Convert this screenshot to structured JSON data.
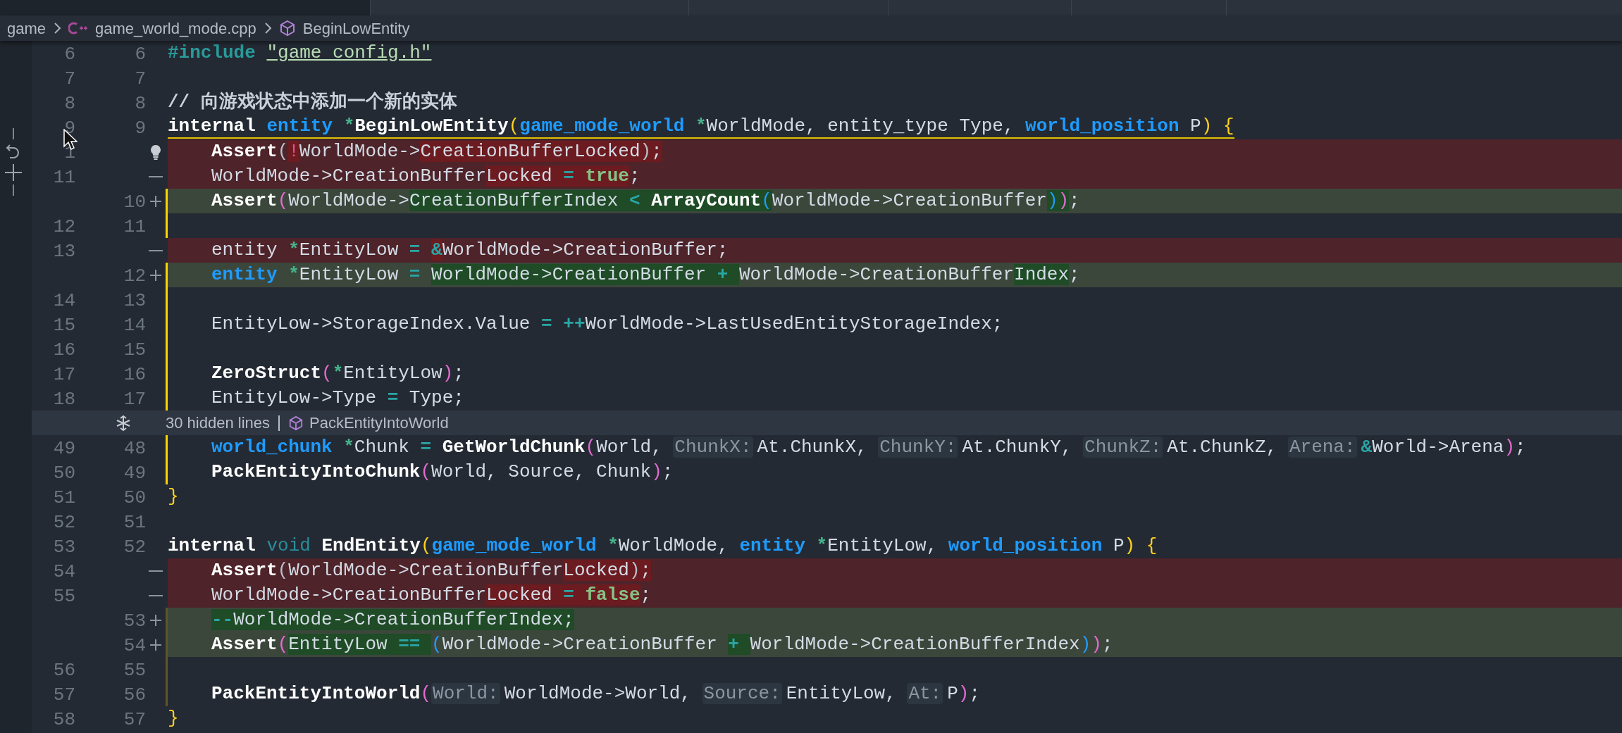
{
  "breadcrumb": [
    {
      "kind": "folder",
      "label": "game"
    },
    {
      "kind": "cpp_file",
      "label": "game_world_mode.cpp"
    },
    {
      "kind": "symbol",
      "label": "BeginLowEntity"
    }
  ],
  "blocks": [
    {
      "kind": "lines",
      "lines": [
        {
          "kind": "context",
          "old": "6",
          "new": "6",
          "guide": false,
          "lightbulb": false,
          "tokens": [
            {
              "kind": "pre",
              "text": "#include "
            },
            {
              "kind": "str",
              "text": "\"game_config.h\""
            }
          ]
        },
        {
          "kind": "context",
          "old": "7",
          "new": "7",
          "guide": false,
          "lightbulb": false
        },
        {
          "kind": "context",
          "old": "8",
          "new": "8",
          "guide": false,
          "lightbulb": false,
          "tokens": [
            {
              "kind": "cmt",
              "text": "// 向游戏状态中添加一个新的实体"
            }
          ]
        },
        {
          "kind": "context",
          "old": "9",
          "new": "9",
          "guide": false,
          "underlined": true,
          "lightbulb": false,
          "tokens": [
            {
              "kind": "kw",
              "text": "internal "
            },
            {
              "kind": "type",
              "text": "entity "
            },
            {
              "kind": "ptr",
              "text": "*"
            },
            {
              "kind": "fn",
              "text": "BeginLowEntity"
            },
            {
              "kind": "py",
              "text": "("
            },
            {
              "kind": "type",
              "text": "game_mode_world "
            },
            {
              "kind": "ptr",
              "text": "*"
            },
            {
              "kind": "plain",
              "text": "WorldMode, entity_type Type, "
            },
            {
              "kind": "type",
              "text": "world_position "
            },
            {
              "kind": "plain",
              "text": "P"
            },
            {
              "kind": "py",
              "text": ")"
            },
            {
              "kind": "py",
              "text": " {"
            }
          ]
        },
        {
          "kind": "deleted",
          "old": "1",
          "indented": true,
          "guide": false,
          "lightbulb": true,
          "tokens": [
            {
              "kind": "fn",
              "text": "Assert",
              "changed": false
            },
            {
              "kind": "pg",
              "text": "(",
              "changed": false
            },
            {
              "kind": "bang",
              "text": "!",
              "changed": true
            },
            {
              "kind": "plain",
              "text": "WorldMode->",
              "changed": false
            },
            {
              "kind": "plain",
              "text": "CreationBufferLocked",
              "changed": true
            },
            {
              "kind": "pg",
              "text": ")",
              "changed": true
            },
            {
              "kind": "plain",
              "text": ";",
              "changed": true
            }
          ]
        },
        {
          "kind": "deleted",
          "old": "11",
          "indented": true,
          "guide": false,
          "lightbulb": false,
          "tokens": [
            {
              "kind": "plain",
              "text": "WorldMode->CreationBuffer",
              "changed": false
            },
            {
              "kind": "plain",
              "text": "Locked",
              "changed": true
            },
            {
              "kind": "op",
              "text": " = ",
              "changed": true
            },
            {
              "kind": "lit",
              "text": "true",
              "changed": true
            },
            {
              "kind": "plain",
              "text": ";",
              "changed": false
            }
          ]
        },
        {
          "kind": "added",
          "new": "10",
          "indented": true,
          "guide": true,
          "dim_guide": false,
          "lightbulb": false,
          "tokens": [
            {
              "kind": "fn",
              "text": "Assert",
              "changed": false
            },
            {
              "kind": "pp",
              "text": "(",
              "changed": false
            },
            {
              "kind": "plain",
              "text": "WorldMode->",
              "changed": false
            },
            {
              "kind": "plain",
              "text": "CreationBufferIndex ",
              "changed": true
            },
            {
              "kind": "op",
              "text": "< ",
              "changed": true
            },
            {
              "kind": "fn",
              "text": "ArrayCount",
              "changed": true
            },
            {
              "kind": "pb",
              "text": "(",
              "changed": true
            },
            {
              "kind": "plain",
              "text": "WorldMode->CreationBuffer",
              "changed": false
            },
            {
              "kind": "pb",
              "text": ")",
              "changed": true
            },
            {
              "kind": "pp",
              "text": ")",
              "changed": true
            },
            {
              "kind": "plain",
              "text": ";",
              "changed": false
            }
          ]
        },
        {
          "kind": "context",
          "old": "12",
          "new": "11",
          "guide": true,
          "dim_guide": false,
          "lightbulb": false
        },
        {
          "kind": "deleted",
          "old": "13",
          "indented": true,
          "guide": false,
          "lightbulb": false,
          "tokens": [
            {
              "kind": "plain",
              "text": "entity ",
              "changed": false
            },
            {
              "kind": "ptr",
              "text": "*",
              "changed": false
            },
            {
              "kind": "plain",
              "text": "EntityLow ",
              "changed": false
            },
            {
              "kind": "op",
              "text": "= ",
              "changed": false
            },
            {
              "kind": "op",
              "text": "&",
              "changed": true
            },
            {
              "kind": "plain",
              "text": "WorldMode->CreationBuffer;",
              "changed": false
            }
          ]
        },
        {
          "kind": "added",
          "new": "12",
          "indented": true,
          "guide": true,
          "dim_guide": false,
          "lightbulb": false,
          "tokens": [
            {
              "kind": "type",
              "text": "entity ",
              "changed": false
            },
            {
              "kind": "ptr",
              "text": "*",
              "changed": false
            },
            {
              "kind": "plain",
              "text": "EntityLow ",
              "changed": false
            },
            {
              "kind": "op",
              "text": "= ",
              "changed": false
            },
            {
              "kind": "plain",
              "text": "WorldMode->CreationBuffer ",
              "changed": true
            },
            {
              "kind": "op",
              "text": "+ ",
              "changed": true
            },
            {
              "kind": "plain",
              "text": "WorldMode->CreationBuffer",
              "changed": false
            },
            {
              "kind": "plain",
              "text": "Index",
              "changed": true
            },
            {
              "kind": "plain",
              "text": ";",
              "changed": false
            }
          ]
        },
        {
          "kind": "context",
          "old": "14",
          "new": "13",
          "guide": true,
          "dim_guide": false,
          "lightbulb": false
        },
        {
          "kind": "context",
          "old": "15",
          "new": "14",
          "indented": true,
          "guide": true,
          "dim_guide": false,
          "lightbulb": false,
          "tokens": [
            {
              "kind": "plain",
              "text": "EntityLow->StorageIndex.Value "
            },
            {
              "kind": "op",
              "text": "= "
            },
            {
              "kind": "op",
              "text": "++"
            },
            {
              "kind": "plain",
              "text": "WorldMode->LastUsedEntityStorageIndex;"
            }
          ]
        },
        {
          "kind": "context",
          "old": "16",
          "new": "15",
          "guide": true,
          "dim_guide": false,
          "lightbulb": false
        },
        {
          "kind": "context",
          "old": "17",
          "new": "16",
          "indented": true,
          "guide": true,
          "dim_guide": false,
          "lightbulb": false,
          "tokens": [
            {
              "kind": "fn",
              "text": "ZeroStruct"
            },
            {
              "kind": "pp",
              "text": "("
            },
            {
              "kind": "ptr",
              "text": "*"
            },
            {
              "kind": "plain",
              "text": "EntityLow"
            },
            {
              "kind": "pp",
              "text": ")"
            },
            {
              "kind": "plain",
              "text": ";"
            }
          ]
        },
        {
          "kind": "context",
          "old": "18",
          "new": "17",
          "indented": true,
          "guide": true,
          "dim_guide": false,
          "lightbulb": false,
          "tokens": [
            {
              "kind": "plain",
              "text": "EntityLow->Type "
            },
            {
              "kind": "op",
              "text": "= "
            },
            {
              "kind": "plain",
              "text": "Type;"
            }
          ]
        }
      ]
    },
    {
      "kind": "hidden",
      "label": "30 hidden lines",
      "symbol": "PackEntityIntoWorld"
    },
    {
      "kind": "lines",
      "lines": [
        {
          "kind": "context",
          "old": "49",
          "new": "48",
          "indented": true,
          "guide": true,
          "dim_guide": false,
          "lightbulb": false,
          "tokens": [
            {
              "kind": "type",
              "text": "world_chunk "
            },
            {
              "kind": "ptr",
              "text": "*"
            },
            {
              "kind": "plain",
              "text": "Chunk "
            },
            {
              "kind": "op",
              "text": "= "
            },
            {
              "kind": "fn",
              "text": "GetWorldChunk"
            },
            {
              "kind": "pp",
              "text": "("
            },
            {
              "kind": "plain",
              "text": "World, "
            },
            {
              "kind": "hint",
              "text": "ChunkX:"
            },
            {
              "kind": "plain",
              "text": "At.ChunkX, "
            },
            {
              "kind": "hint",
              "text": "ChunkY:"
            },
            {
              "kind": "plain",
              "text": "At.ChunkY, "
            },
            {
              "kind": "hint",
              "text": "ChunkZ:"
            },
            {
              "kind": "plain",
              "text": "At.ChunkZ, "
            },
            {
              "kind": "hint",
              "text": "Arena:"
            },
            {
              "kind": "op",
              "text": "&"
            },
            {
              "kind": "plain",
              "text": "World->Arena"
            },
            {
              "kind": "pp",
              "text": ")"
            },
            {
              "kind": "plain",
              "text": ";"
            }
          ]
        },
        {
          "kind": "context",
          "old": "50",
          "new": "49",
          "indented": true,
          "guide": true,
          "dim_guide": false,
          "lightbulb": false,
          "tokens": [
            {
              "kind": "fn",
              "text": "PackEntityIntoChunk"
            },
            {
              "kind": "pp",
              "text": "("
            },
            {
              "kind": "plain",
              "text": "World, Source, Chunk"
            },
            {
              "kind": "pp",
              "text": ")"
            },
            {
              "kind": "plain",
              "text": ";"
            }
          ]
        },
        {
          "kind": "context",
          "old": "51",
          "new": "50",
          "guide": false,
          "lightbulb": false,
          "tokens": [
            {
              "kind": "py",
              "text": "}"
            }
          ]
        },
        {
          "kind": "context",
          "old": "52",
          "new": "51",
          "guide": false,
          "lightbulb": false
        },
        {
          "kind": "context",
          "old": "53",
          "new": "52",
          "guide": false,
          "lightbulb": false,
          "tokens": [
            {
              "kind": "kw",
              "text": "internal "
            },
            {
              "kind": "void",
              "text": "void "
            },
            {
              "kind": "fn",
              "text": "EndEntity"
            },
            {
              "kind": "py",
              "text": "("
            },
            {
              "kind": "type",
              "text": "game_mode_world "
            },
            {
              "kind": "ptr",
              "text": "*"
            },
            {
              "kind": "plain",
              "text": "WorldMode, "
            },
            {
              "kind": "type",
              "text": "entity "
            },
            {
              "kind": "ptr",
              "text": "*"
            },
            {
              "kind": "plain",
              "text": "EntityLow, "
            },
            {
              "kind": "type",
              "text": "world_position "
            },
            {
              "kind": "plain",
              "text": "P"
            },
            {
              "kind": "py",
              "text": ")"
            },
            {
              "kind": "py",
              "text": " {"
            }
          ]
        },
        {
          "kind": "deleted",
          "old": "54",
          "indented": true,
          "guide": false,
          "lightbulb": false,
          "tokens": [
            {
              "kind": "fn",
              "text": "Assert",
              "changed": false
            },
            {
              "kind": "pg",
              "text": "(",
              "changed": false
            },
            {
              "kind": "plain",
              "text": "WorldMode->CreationBuffer",
              "changed": false
            },
            {
              "kind": "plain",
              "text": "Locked",
              "changed": true
            },
            {
              "kind": "pg",
              "text": ")",
              "changed": true
            },
            {
              "kind": "plain",
              "text": ";",
              "changed": true
            }
          ]
        },
        {
          "kind": "deleted",
          "old": "55",
          "indented": true,
          "guide": false,
          "lightbulb": false,
          "tokens": [
            {
              "kind": "plain",
              "text": "WorldMode->CreationBuffer",
              "changed": false
            },
            {
              "kind": "plain",
              "text": "Locked",
              "changed": true
            },
            {
              "kind": "op",
              "text": " = ",
              "changed": true
            },
            {
              "kind": "lit",
              "text": "false",
              "changed": true
            },
            {
              "kind": "plain",
              "text": ";",
              "changed": false
            }
          ]
        },
        {
          "kind": "added",
          "new": "53",
          "indented": true,
          "guide": true,
          "dim_guide": true,
          "lightbulb": false,
          "tokens": [
            {
              "kind": "op",
              "text": "--",
              "changed": true
            },
            {
              "kind": "plain",
              "text": "WorldMode->CreationBufferIndex;",
              "changed": true
            }
          ]
        },
        {
          "kind": "added",
          "new": "54",
          "indented": true,
          "guide": true,
          "dim_guide": true,
          "lightbulb": false,
          "tokens": [
            {
              "kind": "fn",
              "text": "Assert",
              "changed": false
            },
            {
              "kind": "pp",
              "text": "(",
              "changed": false
            },
            {
              "kind": "plain",
              "text": "EntityLow ",
              "changed": true
            },
            {
              "kind": "op",
              "text": "== ",
              "changed": true
            },
            {
              "kind": "pb",
              "text": "(",
              "changed": false
            },
            {
              "kind": "plain",
              "text": "WorldMode->CreationBuffer ",
              "changed": false
            },
            {
              "kind": "op",
              "text": "+ ",
              "changed": true
            },
            {
              "kind": "plain",
              "text": "WorldMode->CreationBufferIndex",
              "changed": false
            },
            {
              "kind": "pb",
              "text": ")",
              "changed": false
            },
            {
              "kind": "pp",
              "text": ")",
              "changed": false
            },
            {
              "kind": "plain",
              "text": ";",
              "changed": false
            }
          ]
        },
        {
          "kind": "context",
          "old": "56",
          "new": "55",
          "guide": true,
          "dim_guide": true,
          "lightbulb": false
        },
        {
          "kind": "context",
          "old": "57",
          "new": "56",
          "indented": true,
          "guide": true,
          "dim_guide": true,
          "lightbulb": false,
          "tokens": [
            {
              "kind": "fn",
              "text": "PackEntityIntoWorld"
            },
            {
              "kind": "pp",
              "text": "("
            },
            {
              "kind": "hint",
              "text": "World:"
            },
            {
              "kind": "plain",
              "text": "WorldMode->World, "
            },
            {
              "kind": "hint",
              "text": "Source:"
            },
            {
              "kind": "plain",
              "text": "EntityLow, "
            },
            {
              "kind": "hint",
              "text": "At:"
            },
            {
              "kind": "plain",
              "text": "P"
            },
            {
              "kind": "pp",
              "text": ")"
            },
            {
              "kind": "plain",
              "text": ";"
            }
          ]
        },
        {
          "kind": "context",
          "old": "58",
          "new": "57",
          "guide": false,
          "lightbulb": false,
          "tokens": [
            {
              "kind": "py",
              "text": "}"
            }
          ]
        }
      ]
    }
  ]
}
